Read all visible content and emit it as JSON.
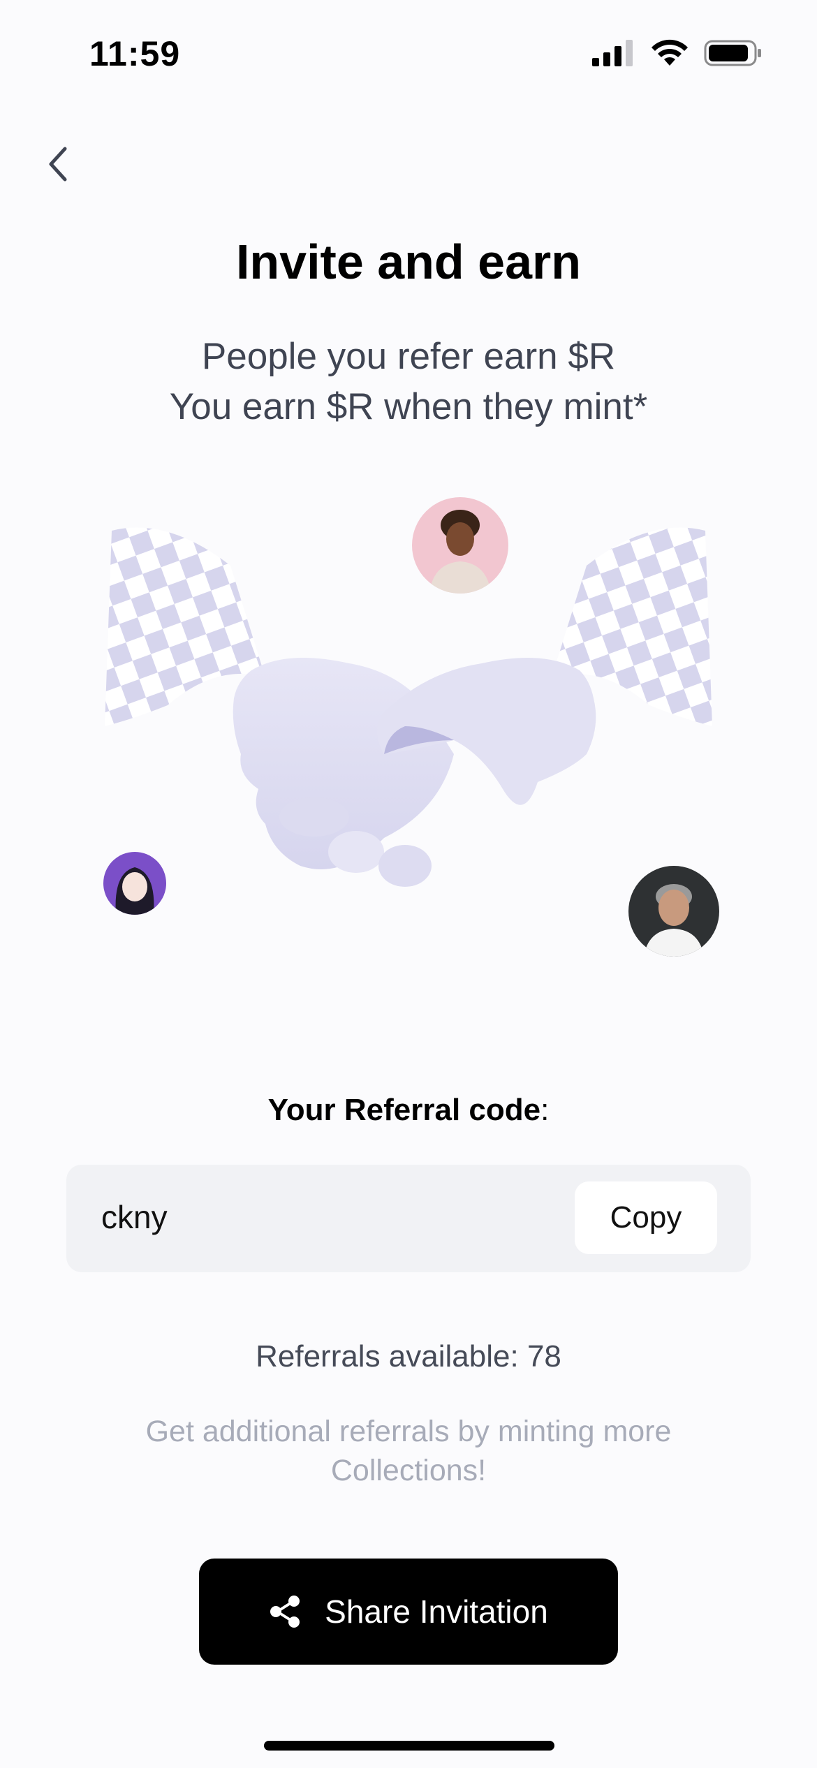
{
  "status_bar": {
    "time": "11:59",
    "icons": [
      "cellular-signal-icon",
      "wifi-icon",
      "battery-icon"
    ]
  },
  "nav": {
    "back_icon": "chevron-left-icon"
  },
  "header": {
    "title": "Invite and earn",
    "subtitle_line1": "People you refer earn $R",
    "subtitle_line2": "You earn $R when they mint*"
  },
  "illustration": {
    "image": "handshake-with-checkered-flags",
    "avatars": [
      "avatar-woman-pink-background",
      "avatar-anime-girl-purple",
      "avatar-smiling-man-dark-background"
    ]
  },
  "referral": {
    "label": "Your Referral code",
    "colon": ":",
    "code": "ckny",
    "copy_label": "Copy",
    "available_text": "Referrals available: 78",
    "hint_line1": "Get additional referrals by minting more",
    "hint_line2": "Collections!"
  },
  "share": {
    "label": "Share Invitation",
    "icon": "share-icon"
  },
  "colors": {
    "background": "#fbfbfd",
    "accent_lavender": "#d9d8ef",
    "button_black": "#000000",
    "subtitle_gray": "#3f4452",
    "hint_gray": "#a7abb8"
  }
}
